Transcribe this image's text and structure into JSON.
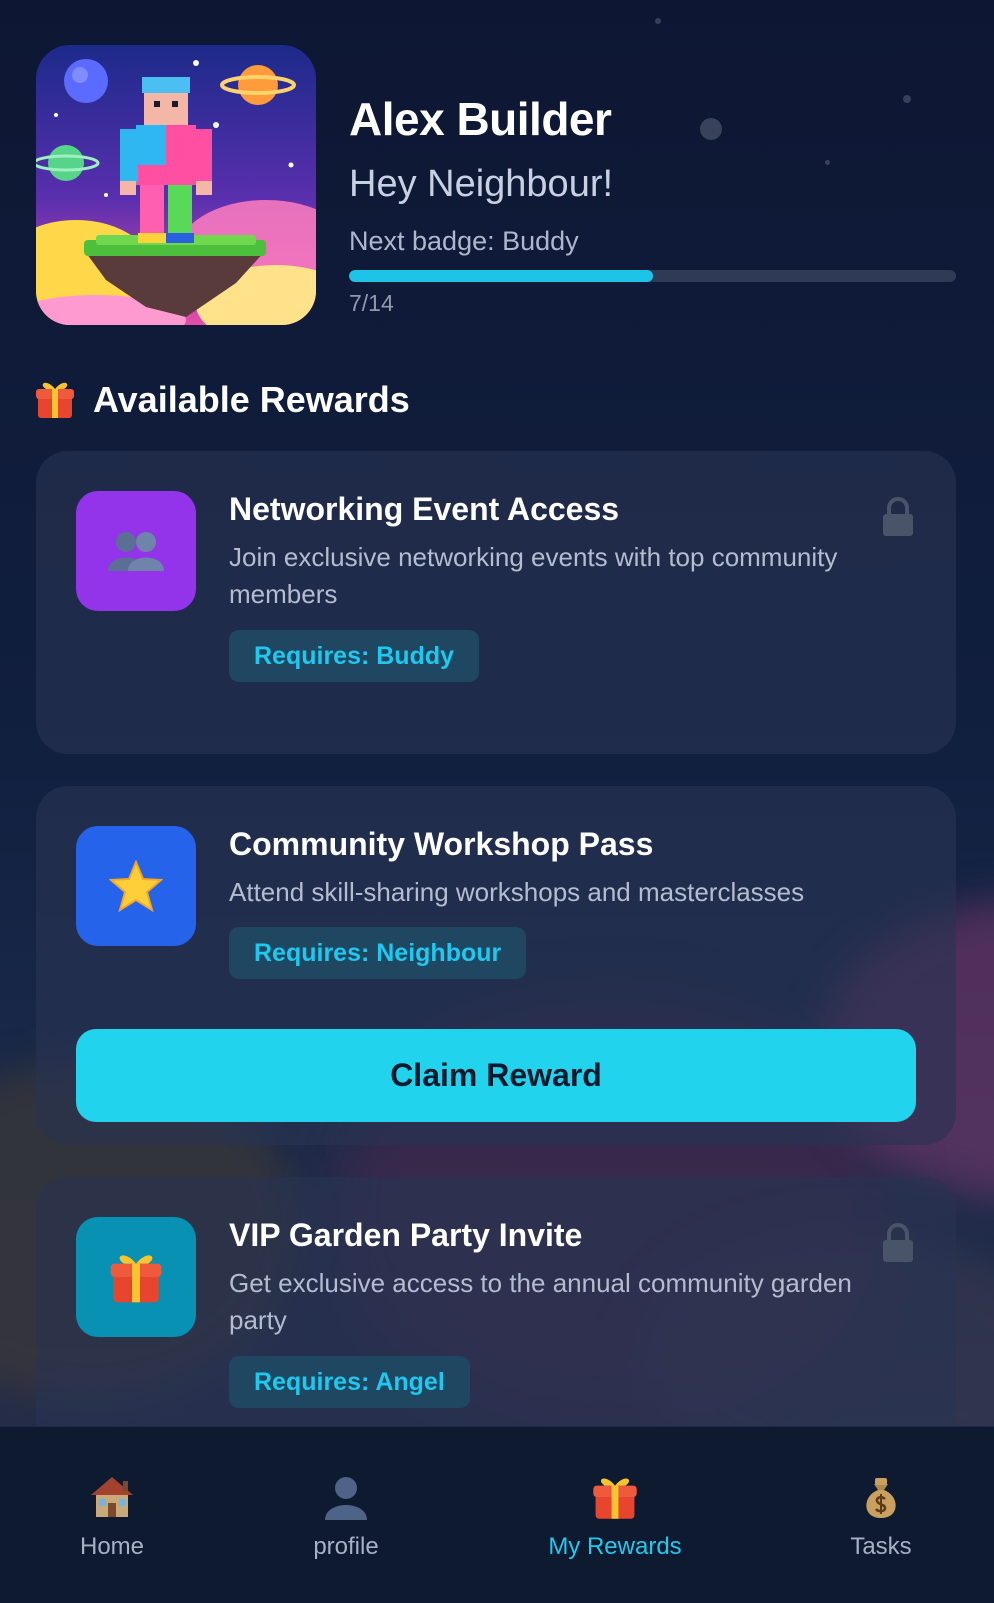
{
  "profile": {
    "name": "Alex Builder",
    "greeting": "Hey Neighbour!",
    "next_badge": "Next badge: Buddy",
    "progress_text": "7/14",
    "progress_fraction": 0.5
  },
  "rewards_section": {
    "title": "Available Rewards",
    "icon": "gift-icon"
  },
  "rewards": [
    {
      "title": "Networking Event Access",
      "description": "Join exclusive networking events with top community members",
      "requirement": "Requires: Buddy",
      "icon": "people-icon",
      "icon_color": "#9333ea",
      "locked": true
    },
    {
      "title": "Community Workshop Pass",
      "description": "Attend skill-sharing workshops and masterclasses",
      "requirement": "Requires: Neighbour",
      "icon": "star-icon",
      "icon_color": "#2563eb",
      "locked": false,
      "action_label": "Claim Reward"
    },
    {
      "title": "VIP Garden Party Invite",
      "description": "Get exclusive access to the annual community garden party",
      "requirement": "Requires: Angel",
      "icon": "gift-icon",
      "icon_color": "#0891b2",
      "locked": true
    }
  ],
  "nav": {
    "items": [
      {
        "label": "Home",
        "icon": "house-icon",
        "active": false
      },
      {
        "label": "profile",
        "icon": "person-icon",
        "active": false
      },
      {
        "label": "My Rewards",
        "icon": "gift-icon",
        "active": true
      },
      {
        "label": "Tasks",
        "icon": "money-bag-icon",
        "active": false
      }
    ]
  },
  "colors": {
    "accent": "#22d3ee",
    "background": "#0f1c38",
    "badge_bg": "#1f4762"
  }
}
